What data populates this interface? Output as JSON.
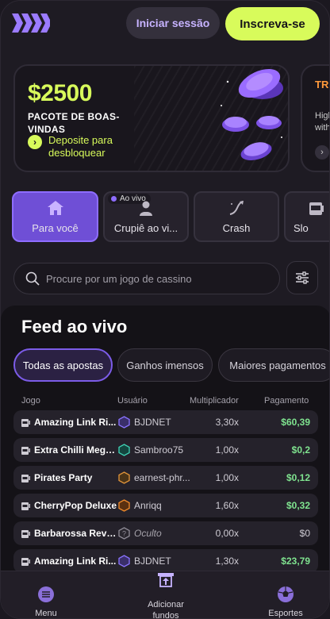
{
  "header": {
    "login_label": "Iniciar sessão",
    "signup_label": "Inscreva-se"
  },
  "promo": {
    "amount": "$2500",
    "title": "PACOTE DE BOAS-VINDAS",
    "cta": "Deposite para desbloquear"
  },
  "promo2": {
    "title": "TR TR",
    "subtitle": "High with"
  },
  "categories": [
    {
      "label": "Para você",
      "icon": "home-icon",
      "active": true
    },
    {
      "label": "Crupiê ao vi...",
      "icon": "dealer-icon",
      "badge": "Ao vivo"
    },
    {
      "label": "Crash",
      "icon": "crash-icon"
    },
    {
      "label": "Slo",
      "icon": "slot-machine-icon"
    }
  ],
  "search": {
    "placeholder": "Procure por um jogo de cassino"
  },
  "feed": {
    "title": "Feed ao vivo",
    "tabs": [
      "Todas as apostas",
      "Ganhos imensos",
      "Maiores pagamentos"
    ],
    "columns": [
      "Jogo",
      "Usuário",
      "Multiplicador",
      "Pagamento"
    ],
    "rows": [
      {
        "game": "Amazing Link Ri...",
        "user": "BJDNET",
        "mult": "3,30x",
        "pay": "$60,39"
      },
      {
        "game": "Extra Chilli Mega...",
        "user": "Sambroo75",
        "mult": "1,00x",
        "pay": "$0,2"
      },
      {
        "game": "Pirates Party",
        "user": "earnest-phr...",
        "mult": "1,00x",
        "pay": "$0,12"
      },
      {
        "game": "CherryPop Deluxe",
        "user": "Anriqq",
        "mult": "1,60x",
        "pay": "$0,32"
      },
      {
        "game": "Barbarossa Reve...",
        "user": "Oculto",
        "mult": "0,00x",
        "pay": "$0"
      },
      {
        "game": "Amazing Link Ri...",
        "user": "BJDNET",
        "mult": "1,30x",
        "pay": "$23,79"
      }
    ]
  },
  "bottom_nav": {
    "menu": "Menu",
    "add_funds": "Adicionar fundos",
    "sports": "Esportes"
  },
  "colors": {
    "accent_lime": "#d8fb5b",
    "accent_purple": "#7c5ce8",
    "payout_green": "#7fe38f",
    "background": "#1e1b23"
  }
}
